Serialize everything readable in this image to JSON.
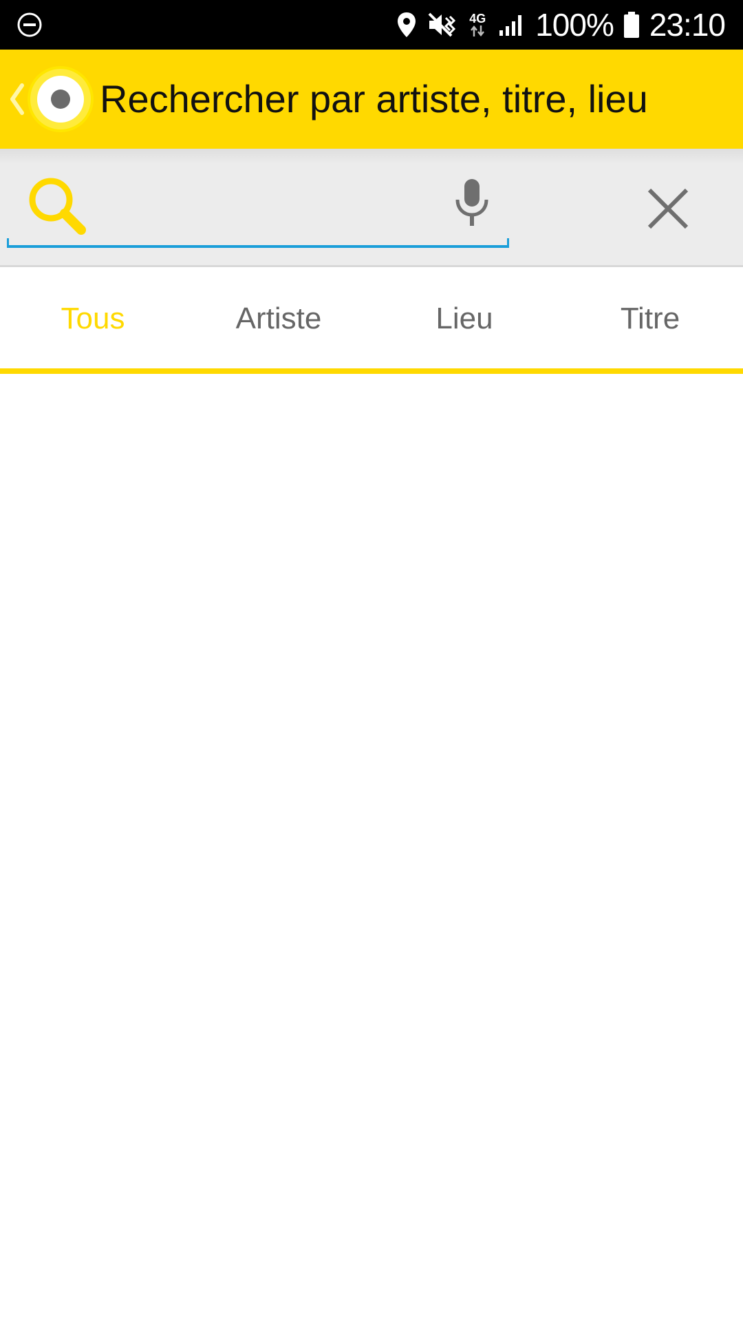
{
  "status_bar": {
    "battery_percent": "100%",
    "time": "23:10",
    "network": "4G",
    "icons": [
      "do-not-disturb-icon",
      "location-icon",
      "mute-icon",
      "network-4g-icon",
      "signal-icon",
      "battery-icon"
    ]
  },
  "app_bar": {
    "title": "Rechercher par artiste, titre, lieu",
    "icons": [
      "back-chevron-icon",
      "app-logo-icon"
    ]
  },
  "search": {
    "value": "",
    "placeholder": "",
    "icons": [
      "search-icon",
      "mic-icon",
      "close-icon"
    ]
  },
  "tabs": [
    {
      "label": "Tous",
      "active": true
    },
    {
      "label": "Artiste",
      "active": false
    },
    {
      "label": "Lieu",
      "active": false
    },
    {
      "label": "Titre",
      "active": false
    }
  ],
  "colors": {
    "accent": "#ffd900",
    "status_bar_bg": "#000000",
    "underline": "#1a9ed9",
    "inactive_tab": "#666666"
  }
}
